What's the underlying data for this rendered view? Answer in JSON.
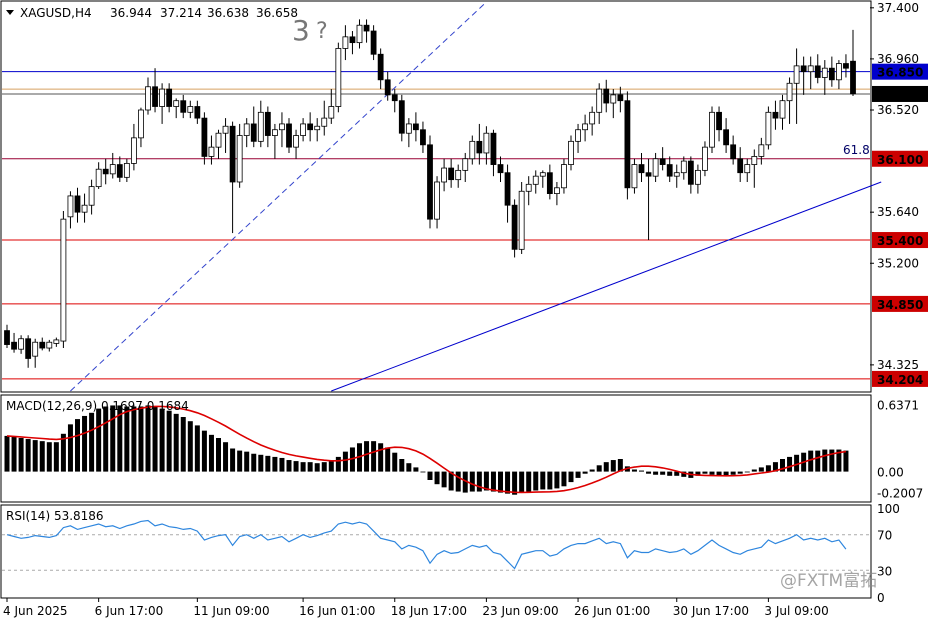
{
  "chart_data": {
    "type": "candlestick",
    "header": {
      "symbol": "XAGUSD,H4",
      "open": "36.944",
      "high": "37.214",
      "low": "36.638",
      "close": "36.658"
    },
    "annotation_wave": "3",
    "annotation_question": "?",
    "fib_label": "61.8",
    "watermark": "@FXTM富拓",
    "price_axis": {
      "ylim": [
        34.1,
        37.45
      ],
      "ticks": [
        "37.400",
        "36.960",
        "36.520",
        "35.640",
        "35.200",
        "34.325"
      ],
      "tick_values": [
        37.4,
        36.96,
        36.52,
        35.64,
        35.2,
        34.325
      ]
    },
    "level_labels": [
      {
        "text": "36.850",
        "value": 36.85,
        "bg": "#0000cc",
        "fg": "#ffffff"
      },
      {
        "text": "36.658",
        "value": 36.658,
        "bg": "#000000",
        "fg": "#ffffff"
      },
      {
        "text": "36.100",
        "value": 36.1,
        "bg": "#cc0000",
        "fg": "#ffffff"
      },
      {
        "text": "35.400",
        "value": 35.4,
        "bg": "#cc0000",
        "fg": "#ffffff"
      },
      {
        "text": "34.850",
        "value": 34.85,
        "bg": "#cc0000",
        "fg": "#ffffff"
      },
      {
        "text": "34.204",
        "value": 34.204,
        "bg": "#cc0000",
        "fg": "#ffffff"
      }
    ],
    "hlines": [
      {
        "value": 36.85,
        "color": "#0000cc"
      },
      {
        "value": 36.7,
        "color": "#d8a060"
      },
      {
        "value": 36.658,
        "color": "#555555"
      },
      {
        "value": 36.1,
        "color": "#990033"
      },
      {
        "value": 35.4,
        "color": "#dd0000"
      },
      {
        "value": 34.85,
        "color": "#dd0000"
      },
      {
        "value": 34.204,
        "color": "#dd0000"
      }
    ],
    "trendline_dashed": {
      "from": [
        9,
        34.1
      ],
      "to": [
        68,
        37.45
      ],
      "color": "#3344cc"
    },
    "trendline_solid": {
      "from": [
        46,
        34.1
      ],
      "to": [
        124,
        35.9
      ],
      "color": "#0000cc"
    },
    "ohlc": [
      [
        34.62,
        34.67,
        34.47,
        34.5
      ],
      [
        34.52,
        34.6,
        34.43,
        34.46
      ],
      [
        34.46,
        34.58,
        34.42,
        34.55
      ],
      [
        34.55,
        34.58,
        34.3,
        34.38
      ],
      [
        34.4,
        34.55,
        34.3,
        34.52
      ],
      [
        34.52,
        34.56,
        34.45,
        34.47
      ],
      [
        34.47,
        34.54,
        34.44,
        34.52
      ],
      [
        34.51,
        34.56,
        34.48,
        34.54
      ],
      [
        34.53,
        35.65,
        34.47,
        35.58
      ],
      [
        35.6,
        35.82,
        35.5,
        35.78
      ],
      [
        35.78,
        35.85,
        35.55,
        35.64
      ],
      [
        35.64,
        35.8,
        35.55,
        35.7
      ],
      [
        35.7,
        35.92,
        35.62,
        35.86
      ],
      [
        35.86,
        36.07,
        35.84,
        36.01
      ],
      [
        36.01,
        36.1,
        35.88,
        35.97
      ],
      [
        35.97,
        36.15,
        35.93,
        36.05
      ],
      [
        36.05,
        36.12,
        35.9,
        35.94
      ],
      [
        35.94,
        36.1,
        35.9,
        36.06
      ],
      [
        36.06,
        36.4,
        36.0,
        36.28
      ],
      [
        36.28,
        36.54,
        36.2,
        36.52
      ],
      [
        36.52,
        36.8,
        36.48,
        36.72
      ],
      [
        36.72,
        36.88,
        36.5,
        36.55
      ],
      [
        36.55,
        36.75,
        36.4,
        36.7
      ],
      [
        36.7,
        36.75,
        36.5,
        36.55
      ],
      [
        36.55,
        36.62,
        36.45,
        36.6
      ],
      [
        36.6,
        36.65,
        36.45,
        36.5
      ],
      [
        36.5,
        36.6,
        36.45,
        36.55
      ],
      [
        36.55,
        36.6,
        36.4,
        36.45
      ],
      [
        36.45,
        36.5,
        36.05,
        36.12
      ],
      [
        36.12,
        36.3,
        36.05,
        36.2
      ],
      [
        36.2,
        36.35,
        36.1,
        36.32
      ],
      [
        36.32,
        36.45,
        36.15,
        36.38
      ],
      [
        36.38,
        36.42,
        35.46,
        35.9
      ],
      [
        35.9,
        36.4,
        35.85,
        36.3
      ],
      [
        36.3,
        36.45,
        36.2,
        36.4
      ],
      [
        36.4,
        36.55,
        36.2,
        36.25
      ],
      [
        36.25,
        36.6,
        36.2,
        36.5
      ],
      [
        36.5,
        36.55,
        36.2,
        36.3
      ],
      [
        36.3,
        36.4,
        36.1,
        36.35
      ],
      [
        36.35,
        36.5,
        36.2,
        36.4
      ],
      [
        36.4,
        36.45,
        36.15,
        36.2
      ],
      [
        36.2,
        36.35,
        36.1,
        36.3
      ],
      [
        36.3,
        36.45,
        36.25,
        36.4
      ],
      [
        36.4,
        36.5,
        36.25,
        36.35
      ],
      [
        36.35,
        36.45,
        36.25,
        36.38
      ],
      [
        36.38,
        36.6,
        36.3,
        36.45
      ],
      [
        36.45,
        36.7,
        36.4,
        36.55
      ],
      [
        36.55,
        37.1,
        36.5,
        37.05
      ],
      [
        37.05,
        37.25,
        36.95,
        37.15
      ],
      [
        37.15,
        37.2,
        37.0,
        37.1
      ],
      [
        37.1,
        37.3,
        37.05,
        37.25
      ],
      [
        37.25,
        37.3,
        37.1,
        37.2
      ],
      [
        37.2,
        37.25,
        36.95,
        37.0
      ],
      [
        37.0,
        37.05,
        36.7,
        36.78
      ],
      [
        36.78,
        36.85,
        36.6,
        36.65
      ],
      [
        36.65,
        36.7,
        36.5,
        36.6
      ],
      [
        36.6,
        36.65,
        36.25,
        36.32
      ],
      [
        36.32,
        36.45,
        36.2,
        36.4
      ],
      [
        36.4,
        36.5,
        36.25,
        36.35
      ],
      [
        36.35,
        36.42,
        36.15,
        36.22
      ],
      [
        36.22,
        36.3,
        35.5,
        35.58
      ],
      [
        35.58,
        35.95,
        35.5,
        35.9
      ],
      [
        35.9,
        36.1,
        35.82,
        36.02
      ],
      [
        36.02,
        36.1,
        35.85,
        35.92
      ],
      [
        35.92,
        36.05,
        35.85,
        36.0
      ],
      [
        36.0,
        36.15,
        35.9,
        36.1
      ],
      [
        36.1,
        36.3,
        36.05,
        36.25
      ],
      [
        36.25,
        36.4,
        36.05,
        36.15
      ],
      [
        36.15,
        36.38,
        36.05,
        36.32
      ],
      [
        36.32,
        36.35,
        35.95,
        36.05
      ],
      [
        36.05,
        36.12,
        35.9,
        35.98
      ],
      [
        35.98,
        36.05,
        35.55,
        35.7
      ],
      [
        35.7,
        35.75,
        35.25,
        35.32
      ],
      [
        35.32,
        35.9,
        35.28,
        35.82
      ],
      [
        35.82,
        35.95,
        35.7,
        35.88
      ],
      [
        35.88,
        36.0,
        35.8,
        35.95
      ],
      [
        35.95,
        36.0,
        35.85,
        35.98
      ],
      [
        35.98,
        36.05,
        35.75,
        35.8
      ],
      [
        35.8,
        35.9,
        35.7,
        35.85
      ],
      [
        35.85,
        36.1,
        35.8,
        36.05
      ],
      [
        36.05,
        36.3,
        36.0,
        36.25
      ],
      [
        36.25,
        36.4,
        36.15,
        36.35
      ],
      [
        36.35,
        36.48,
        36.25,
        36.4
      ],
      [
        36.4,
        36.55,
        36.3,
        36.5
      ],
      [
        36.5,
        36.75,
        36.4,
        36.7
      ],
      [
        36.7,
        36.78,
        36.5,
        36.58
      ],
      [
        36.58,
        36.7,
        36.45,
        36.65
      ],
      [
        36.65,
        36.72,
        36.5,
        36.6
      ],
      [
        36.6,
        36.68,
        35.75,
        35.85
      ],
      [
        35.85,
        36.1,
        35.8,
        36.05
      ],
      [
        36.05,
        36.15,
        35.9,
        35.98
      ],
      [
        35.98,
        36.1,
        35.4,
        35.95
      ],
      [
        35.95,
        36.15,
        35.9,
        36.1
      ],
      [
        36.1,
        36.2,
        36.0,
        36.05
      ],
      [
        36.05,
        36.12,
        35.9,
        35.95
      ],
      [
        35.95,
        36.05,
        35.85,
        35.98
      ],
      [
        35.98,
        36.12,
        35.92,
        36.08
      ],
      [
        36.08,
        36.12,
        35.8,
        35.88
      ],
      [
        35.88,
        36.05,
        35.8,
        36.0
      ],
      [
        36.0,
        36.25,
        35.95,
        36.2
      ],
      [
        36.2,
        36.55,
        36.15,
        36.5
      ],
      [
        36.5,
        36.55,
        36.25,
        36.35
      ],
      [
        36.35,
        36.45,
        36.15,
        36.22
      ],
      [
        36.22,
        36.3,
        36.05,
        36.1
      ],
      [
        36.1,
        36.2,
        35.9,
        35.98
      ],
      [
        35.98,
        36.1,
        35.9,
        36.05
      ],
      [
        36.05,
        36.18,
        35.85,
        36.12
      ],
      [
        36.12,
        36.28,
        36.05,
        36.22
      ],
      [
        36.22,
        36.55,
        36.18,
        36.5
      ],
      [
        36.5,
        36.6,
        36.35,
        36.45
      ],
      [
        36.45,
        36.65,
        36.35,
        36.6
      ],
      [
        36.6,
        36.8,
        36.4,
        36.75
      ],
      [
        36.75,
        37.05,
        36.4,
        36.9
      ],
      [
        36.9,
        36.98,
        36.65,
        36.85
      ],
      [
        36.85,
        36.98,
        36.7,
        36.9
      ],
      [
        36.9,
        37.0,
        36.75,
        36.8
      ],
      [
        36.8,
        36.95,
        36.65,
        36.88
      ],
      [
        36.88,
        36.98,
        36.72,
        36.78
      ],
      [
        36.78,
        36.95,
        36.7,
        36.92
      ],
      [
        36.92,
        37.0,
        36.8,
        36.88
      ],
      [
        36.94,
        37.21,
        36.64,
        36.66
      ]
    ],
    "x_axis_labels": [
      {
        "text": "4 Jun 2025",
        "bar": 0
      },
      {
        "text": "6 Jun 17:00",
        "bar": 13
      },
      {
        "text": "11 Jun 09:00",
        "bar": 27
      },
      {
        "text": "16 Jun 01:00",
        "bar": 42
      },
      {
        "text": "18 Jun 17:00",
        "bar": 55
      },
      {
        "text": "23 Jun 09:00",
        "bar": 68
      },
      {
        "text": "26 Jun 01:00",
        "bar": 81
      },
      {
        "text": "30 Jun 17:00",
        "bar": 95
      },
      {
        "text": "3 Jul 09:00",
        "bar": 108
      }
    ],
    "macd": {
      "label": "MACD(12,26,9) 0.1697 0.1684",
      "ticks": [
        "0.6371",
        "0.00",
        "-0.2007"
      ],
      "ylim": [
        -0.28,
        0.72
      ],
      "tick_values": [
        0.6371,
        0.0,
        -0.2007
      ],
      "histogram": [
        0.34,
        0.33,
        0.32,
        0.31,
        0.3,
        0.29,
        0.28,
        0.28,
        0.36,
        0.45,
        0.5,
        0.53,
        0.56,
        0.6,
        0.62,
        0.63,
        0.63,
        0.62,
        0.62,
        0.62,
        0.63,
        0.62,
        0.6,
        0.58,
        0.55,
        0.52,
        0.48,
        0.44,
        0.39,
        0.35,
        0.32,
        0.28,
        0.22,
        0.2,
        0.19,
        0.17,
        0.16,
        0.15,
        0.14,
        0.13,
        0.11,
        0.1,
        0.09,
        0.09,
        0.08,
        0.09,
        0.1,
        0.14,
        0.19,
        0.23,
        0.27,
        0.29,
        0.29,
        0.27,
        0.23,
        0.18,
        0.12,
        0.08,
        0.04,
        0.0,
        -0.08,
        -0.12,
        -0.15,
        -0.18,
        -0.19,
        -0.2,
        -0.19,
        -0.19,
        -0.18,
        -0.19,
        -0.2,
        -0.21,
        -0.22,
        -0.2,
        -0.19,
        -0.18,
        -0.17,
        -0.17,
        -0.16,
        -0.14,
        -0.1,
        -0.06,
        -0.02,
        0.02,
        0.06,
        0.09,
        0.11,
        0.12,
        0.05,
        0.02,
        0.01,
        -0.02,
        -0.03,
        -0.03,
        -0.04,
        -0.04,
        -0.05,
        -0.06,
        -0.04,
        -0.02,
        -0.03,
        -0.04,
        -0.04,
        -0.03,
        -0.02,
        0.0,
        0.02,
        0.04,
        0.06,
        0.09,
        0.12,
        0.14,
        0.16,
        0.18,
        0.2,
        0.2,
        0.21,
        0.21,
        0.21,
        0.2
      ],
      "signal_color": "#dd0000"
    },
    "rsi": {
      "label": "RSI(14) 53.8186",
      "ticks": [
        "100",
        "70",
        "30",
        "0"
      ],
      "ylim": [
        0,
        100
      ],
      "tick_values": [
        100,
        70,
        30,
        0
      ],
      "line_color": "#2e86de",
      "values": [
        70,
        68,
        66,
        67,
        69,
        68,
        67,
        69,
        78,
        80,
        76,
        78,
        80,
        82,
        79,
        80,
        77,
        80,
        82,
        85,
        86,
        80,
        82,
        79,
        78,
        76,
        77,
        74,
        64,
        67,
        69,
        70,
        58,
        68,
        70,
        66,
        70,
        64,
        66,
        68,
        62,
        66,
        70,
        67,
        69,
        72,
        74,
        82,
        84,
        82,
        84,
        82,
        74,
        66,
        64,
        62,
        54,
        58,
        56,
        52,
        38,
        48,
        52,
        49,
        50,
        54,
        58,
        56,
        58,
        50,
        48,
        40,
        32,
        48,
        50,
        52,
        52,
        46,
        48,
        54,
        58,
        60,
        60,
        63,
        66,
        60,
        62,
        60,
        44,
        52,
        50,
        50,
        54,
        52,
        50,
        51,
        54,
        48,
        52,
        58,
        64,
        58,
        54,
        50,
        48,
        52,
        54,
        56,
        64,
        60,
        63,
        66,
        70,
        64,
        66,
        64,
        66,
        62,
        64,
        53.8
      ]
    }
  }
}
